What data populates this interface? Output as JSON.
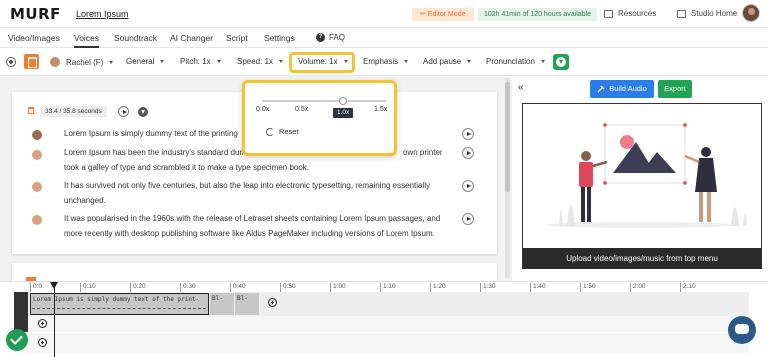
{
  "header": {
    "logo": "MURF",
    "project_name": "Lorem Ipsum",
    "editor_badge": "✏ Editor Mode",
    "time_badge": "102h 41min of 120 hours available",
    "resources_label": "Resources",
    "studio_home_label": "Studio Home"
  },
  "tabs": [
    {
      "label": "Video/Images"
    },
    {
      "label": "Voices"
    },
    {
      "label": "Soundtrack"
    },
    {
      "label": "AI Changer"
    },
    {
      "label": "Script"
    },
    {
      "label": "Settings"
    }
  ],
  "faq_label": "FAQ",
  "toolbar": {
    "voice": "Rachel (F)",
    "style": "General",
    "pitch": "Pitch: 1x",
    "speed": "Speed: 1x",
    "volume": "Volume: 1x",
    "emphasis": "Emphasis",
    "add_pause": "Add pause",
    "pronunciation": "Pronunciation"
  },
  "volume_popup": {
    "ticks": [
      "0.0x",
      "0.5x",
      "1.0x",
      "1.5x"
    ],
    "current": "1.0x",
    "reset_label": "Reset"
  },
  "block": {
    "duration": "33.4 / 35.8 seconds",
    "lines": [
      "Lorem Ipsum is simply dummy text of the printing",
      "Lorem Ipsum has been the industry's standard dum",
      "own printer",
      "took a galley of type and scrambled it to make a type specimen book.",
      "It has survived not only five centuries, but also the leap into electronic typesetting, remaining essentially",
      "unchanged.",
      "It was popularised in the 1960s with the release of Letraset sheets containing Lorem Ipsum passages, and",
      "more recently with desktop publishing software like Aldus PageMaker including versions of Lorem Ipsum."
    ]
  },
  "right_panel": {
    "build_audio_label": "Build Audio",
    "export_label": "Export",
    "upload_message": "Upload video/images/music from top menu"
  },
  "timeline": {
    "ruler": [
      "0:0",
      "0:10",
      "0:20",
      "0:30",
      "0:40",
      "0:50",
      "1:00",
      "1:10",
      "1:20",
      "1:30",
      "1:40",
      "1:50",
      "2:00",
      "2:10"
    ],
    "clip_text": "Lorem Ipsum is simply dummy text of the print-",
    "clip_sm1": "Bl-",
    "clip_sm2": "Bl-"
  },
  "colors": {
    "highlight": "#f4c430",
    "primary_blue": "#2b7de9",
    "green": "#21a356",
    "orange": "#f47c2c"
  }
}
